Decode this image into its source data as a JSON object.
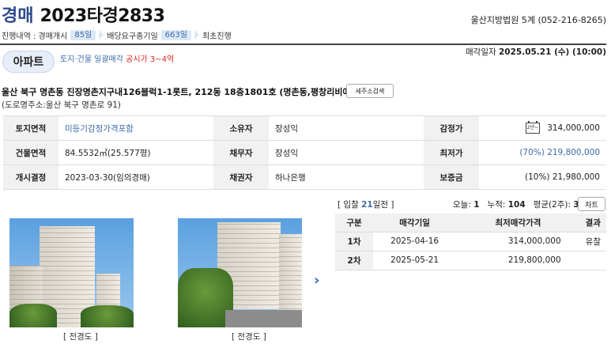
{
  "header": {
    "auction_word": "경매",
    "case_no": "2023타경2833",
    "court": "울산지방법원 5계 (052-216-8265)"
  },
  "progress": {
    "prefix": "진행내역 : 경매개시",
    "days1": "85일",
    "mid": "배당요구종기일",
    "days2": "663일",
    "suffix": "최초진행"
  },
  "type_tag": "아파트",
  "lump": {
    "text": "토지·건물 일괄매각",
    "notice": "공시가 3~4억"
  },
  "sale_date": {
    "label": "매각일자",
    "value": "2025.05.21 (수) (10:00)"
  },
  "address": "울산 북구 명촌동 진장명촌지구내126블럭1-1롯트, 212동 18층1801호 (명촌동,평창리비에르2차)",
  "search_button": "세주소검색",
  "road_address": "(도로명주소:울산 북구 명촌로 91)",
  "info": {
    "rows": [
      {
        "l1": "토지면적",
        "v1": "미등기감정가격포함",
        "l2": "소유자",
        "v2": "장성익",
        "l3": "감정가",
        "v3": "314,000,000"
      },
      {
        "l1": "건물면적",
        "v1": "84.5532㎡(25.577평)",
        "l2": "채무자",
        "v2": "장성익",
        "l3": "최저가",
        "v3": "(70%) 219,800,000"
      },
      {
        "l1": "개시결정",
        "v1": "2023-03-30(임의경매)",
        "l2": "채권자",
        "v2": "하나은행",
        "l3": "보증금",
        "v3": "(10%) 21,980,000"
      }
    ],
    "cal_icon_text": "2년~"
  },
  "bid": {
    "prefix": "[ 입찰 ",
    "days": "21",
    "suffix": "일전 ]",
    "today_label": "오늘: ",
    "today": "1",
    "total_label": "누적: ",
    "total": "104",
    "avg_label": "평균(2주): ",
    "avg": "3",
    "chart_button": "차트"
  },
  "rounds": {
    "headers": [
      "구분",
      "매각기일",
      "최저매각가격",
      "결과"
    ],
    "rows": [
      {
        "round": "1차",
        "date": "2025-04-16",
        "price": "314,000,000",
        "result": "유찰"
      },
      {
        "round": "2차",
        "date": "2025-05-21",
        "price": "219,800,000",
        "result": ""
      }
    ]
  },
  "photos": [
    {
      "label": "[ 전경도 ]"
    },
    {
      "label": "[ 전경도 ]"
    }
  ],
  "colors": {
    "accent": "#3c6aa8",
    "title": "#2b4a8b",
    "notice": "#dd2222"
  }
}
